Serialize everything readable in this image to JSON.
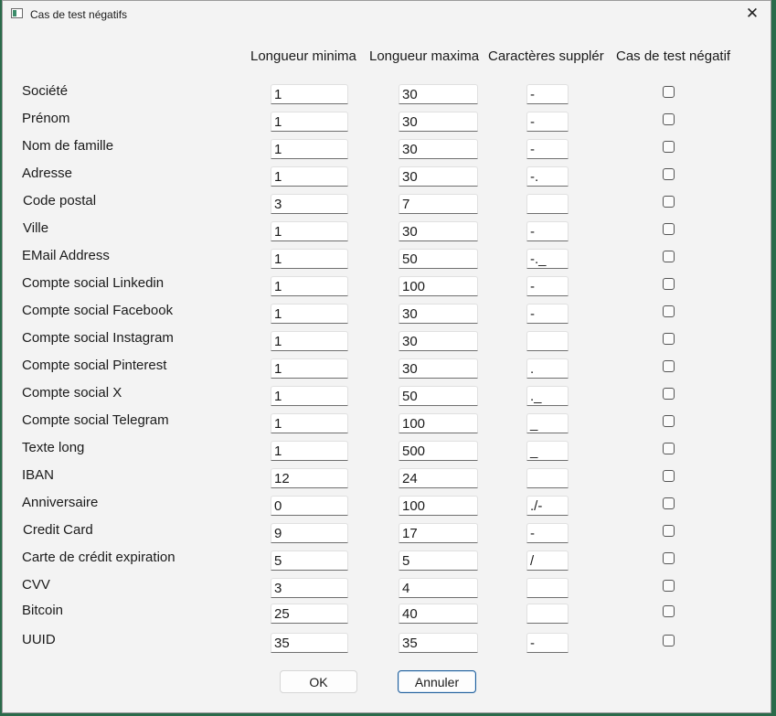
{
  "window": {
    "title": "Cas de test négatifs",
    "close_glyph": "✕"
  },
  "headers": [
    "Longueur minima",
    "Longueur maxima",
    "Caractères supplér",
    "Cas de test négatif"
  ],
  "rows": [
    {
      "label": "Société",
      "min": "1",
      "max": "30",
      "chars": "-",
      "negative": false
    },
    {
      "label": "Prénom",
      "min": "1",
      "max": "30",
      "chars": "-",
      "negative": false
    },
    {
      "label": "Nom de famille",
      "min": "1",
      "max": "30",
      "chars": "-",
      "negative": false
    },
    {
      "label": "Adresse",
      "min": "1",
      "max": "30",
      "chars": "-.",
      "negative": false
    },
    {
      "label": "Code postal",
      "min": "3",
      "max": "7",
      "chars": "",
      "negative": false
    },
    {
      "label": "Ville",
      "min": "1",
      "max": "30",
      "chars": "-",
      "negative": false
    },
    {
      "label": "EMail Address",
      "min": "1",
      "max": "50",
      "chars": "-._",
      "negative": false
    },
    {
      "label": "Compte social Linkedin",
      "min": "1",
      "max": "100",
      "chars": "-",
      "negative": false
    },
    {
      "label": "Compte social Facebook",
      "min": "1",
      "max": "30",
      "chars": "-",
      "negative": false
    },
    {
      "label": "Compte social Instagram",
      "min": "1",
      "max": "30",
      "chars": "",
      "negative": false
    },
    {
      "label": "Compte social Pinterest",
      "min": "1",
      "max": "30",
      "chars": ".",
      "negative": false
    },
    {
      "label": "Compte social X",
      "min": "1",
      "max": "50",
      "chars": "._",
      "negative": false
    },
    {
      "label": "Compte social Telegram",
      "min": "1",
      "max": "100",
      "chars": "_",
      "negative": false
    },
    {
      "label": "Texte long",
      "min": "1",
      "max": "500",
      "chars": "_",
      "negative": false
    },
    {
      "label": "IBAN",
      "min": "12",
      "max": "24",
      "chars": "",
      "negative": false
    },
    {
      "label": "Anniversaire",
      "min": "0",
      "max": "100",
      "chars": "./-",
      "negative": false
    },
    {
      "label": "Credit Card",
      "min": "9",
      "max": "17",
      "chars": " -",
      "negative": false
    },
    {
      "label": "Carte de crédit expiration",
      "min": "5",
      "max": "5",
      "chars": "/",
      "negative": false
    },
    {
      "label": "CVV",
      "min": "3",
      "max": "4",
      "chars": "",
      "negative": false
    },
    {
      "label": "Bitcoin",
      "min": "25",
      "max": "40",
      "chars": "",
      "negative": false
    },
    {
      "label": "UUID",
      "min": "35",
      "max": "35",
      "chars": "-",
      "negative": false
    }
  ],
  "buttons": {
    "ok": "OK",
    "cancel": "Annuler"
  }
}
